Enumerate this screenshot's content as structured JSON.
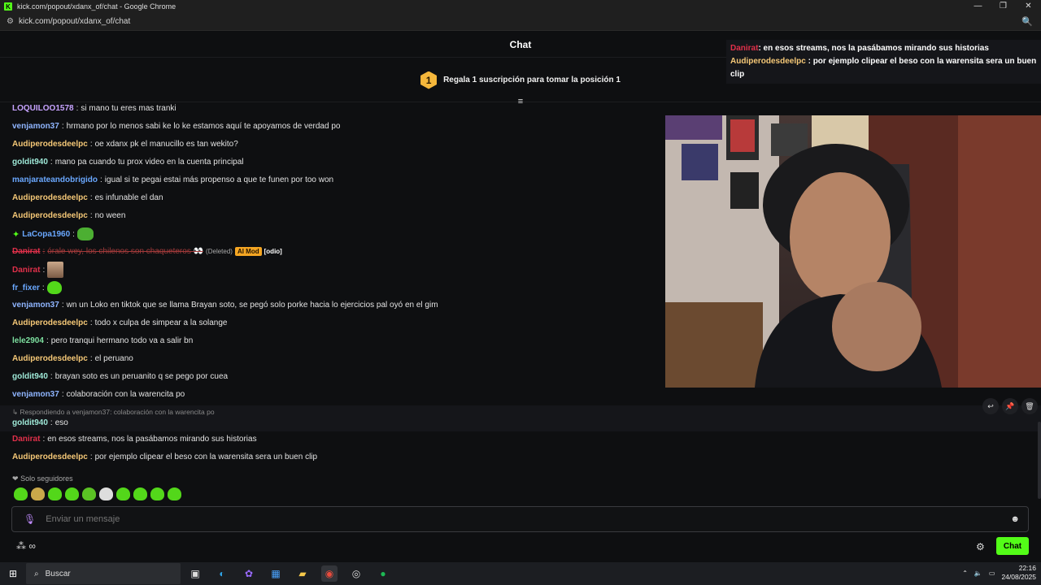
{
  "window": {
    "title": "kick.com/popout/xdanx_of/chat - Google Chrome",
    "favicon_letter": "K",
    "controls": [
      "—",
      "❐",
      "✕"
    ]
  },
  "address": {
    "url": "kick.com/popout/xdanx_of/chat"
  },
  "chat": {
    "title": "Chat",
    "sub_banner": {
      "rank": "1",
      "text": "Regala 1 suscripción para tomar la posición 1"
    },
    "messages": [
      {
        "user": "LOQUILOO1578",
        "color": "#c7a3ff",
        "text": "si mano tu eres mas tranki"
      },
      {
        "user": "venjamon37",
        "color": "#8fb5ff",
        "text": "hrmano por lo menos sabi ke lo ke estamos aquí te apoyamos de verdad po"
      },
      {
        "user": "Audiperodesdeelpc",
        "color": "#f5c877",
        "text": "oe xdanx pk el manucillo es tan wekito?"
      },
      {
        "user": "goldit940",
        "color": "#9ee8d7",
        "text": "mano pa cuando tu prox video en la cuenta principal"
      },
      {
        "user": "manjarateandobrigido",
        "color": "#6aa8ff",
        "text": "igual si te pegai estai más propenso a que te funen por too won"
      },
      {
        "user": "Audiperodesdeelpc",
        "color": "#f5c877",
        "text": "es infunable el dan"
      },
      {
        "user": "Audiperodesdeelpc",
        "color": "#f5c877",
        "text": "no ween"
      },
      {
        "user": "LaCopa1960",
        "color": "#6aa8ff",
        "text": ""
      },
      {
        "user": "Danirat",
        "color": "#e0304a",
        "text": "órale wey, los chilenos son chaqueteros 👀",
        "deleted_tag": "(Deleted)",
        "mod_badge": "AI Mod",
        "reason": "[odio]"
      },
      {
        "user": "Danirat",
        "color": "#e0304a",
        "text": ""
      },
      {
        "user": "fr_fixer",
        "color": "#6aa8ff",
        "text": ""
      },
      {
        "user": "venjamon37",
        "color": "#8fb5ff",
        "text": "wn un Loko en tiktok que se llama Brayan soto, se pegó solo porke hacia lo ejercicios pal oyó en el gim"
      },
      {
        "user": "Audiperodesdeelpc",
        "color": "#f5c877",
        "text": "todo x culpa de simpear a la solange"
      },
      {
        "user": "lele2904",
        "color": "#7de0a0",
        "text": "pero tranqui hermano todo va a salir bn"
      },
      {
        "user": "Audiperodesdeelpc",
        "color": "#f5c877",
        "text": "el peruano"
      },
      {
        "user": "goldit940",
        "color": "#9ee8d7",
        "text": "brayan soto es un peruanito q se pego por cuea"
      },
      {
        "user": "venjamon37",
        "color": "#8fb5ff",
        "text": "colaboración con la warencita po"
      }
    ],
    "reply": {
      "reference": "Respondiendo a venjamon37: colaboración con la warencita po",
      "user": "goldit940",
      "color": "#9ee8d7",
      "text": "eso"
    },
    "after": [
      {
        "user": "Danirat",
        "color": "#e0304a",
        "text": "en esos streams, nos la pasábamos mirando sus historias"
      },
      {
        "user": "Audiperodesdeelpc",
        "color": "#f5c877",
        "text": "por ejemplo clipear el beso con la warensita sera un buen clip"
      }
    ],
    "followers_only": "Solo seguidores",
    "input_placeholder": "Enviar un mensaje",
    "chat_button": "Chat"
  },
  "overlay": {
    "line1_user": "Danirat",
    "line1_text": ": en esos streams, nos la pasábamos mirando sus historias",
    "line2_user": "Audiperodesdeelpc",
    "line2_text": " : por ejemplo clipear el beso con la warensita sera un buen clip"
  },
  "taskbar": {
    "search_placeholder": "Buscar",
    "time": "22:16",
    "date": "24/08/2025"
  }
}
